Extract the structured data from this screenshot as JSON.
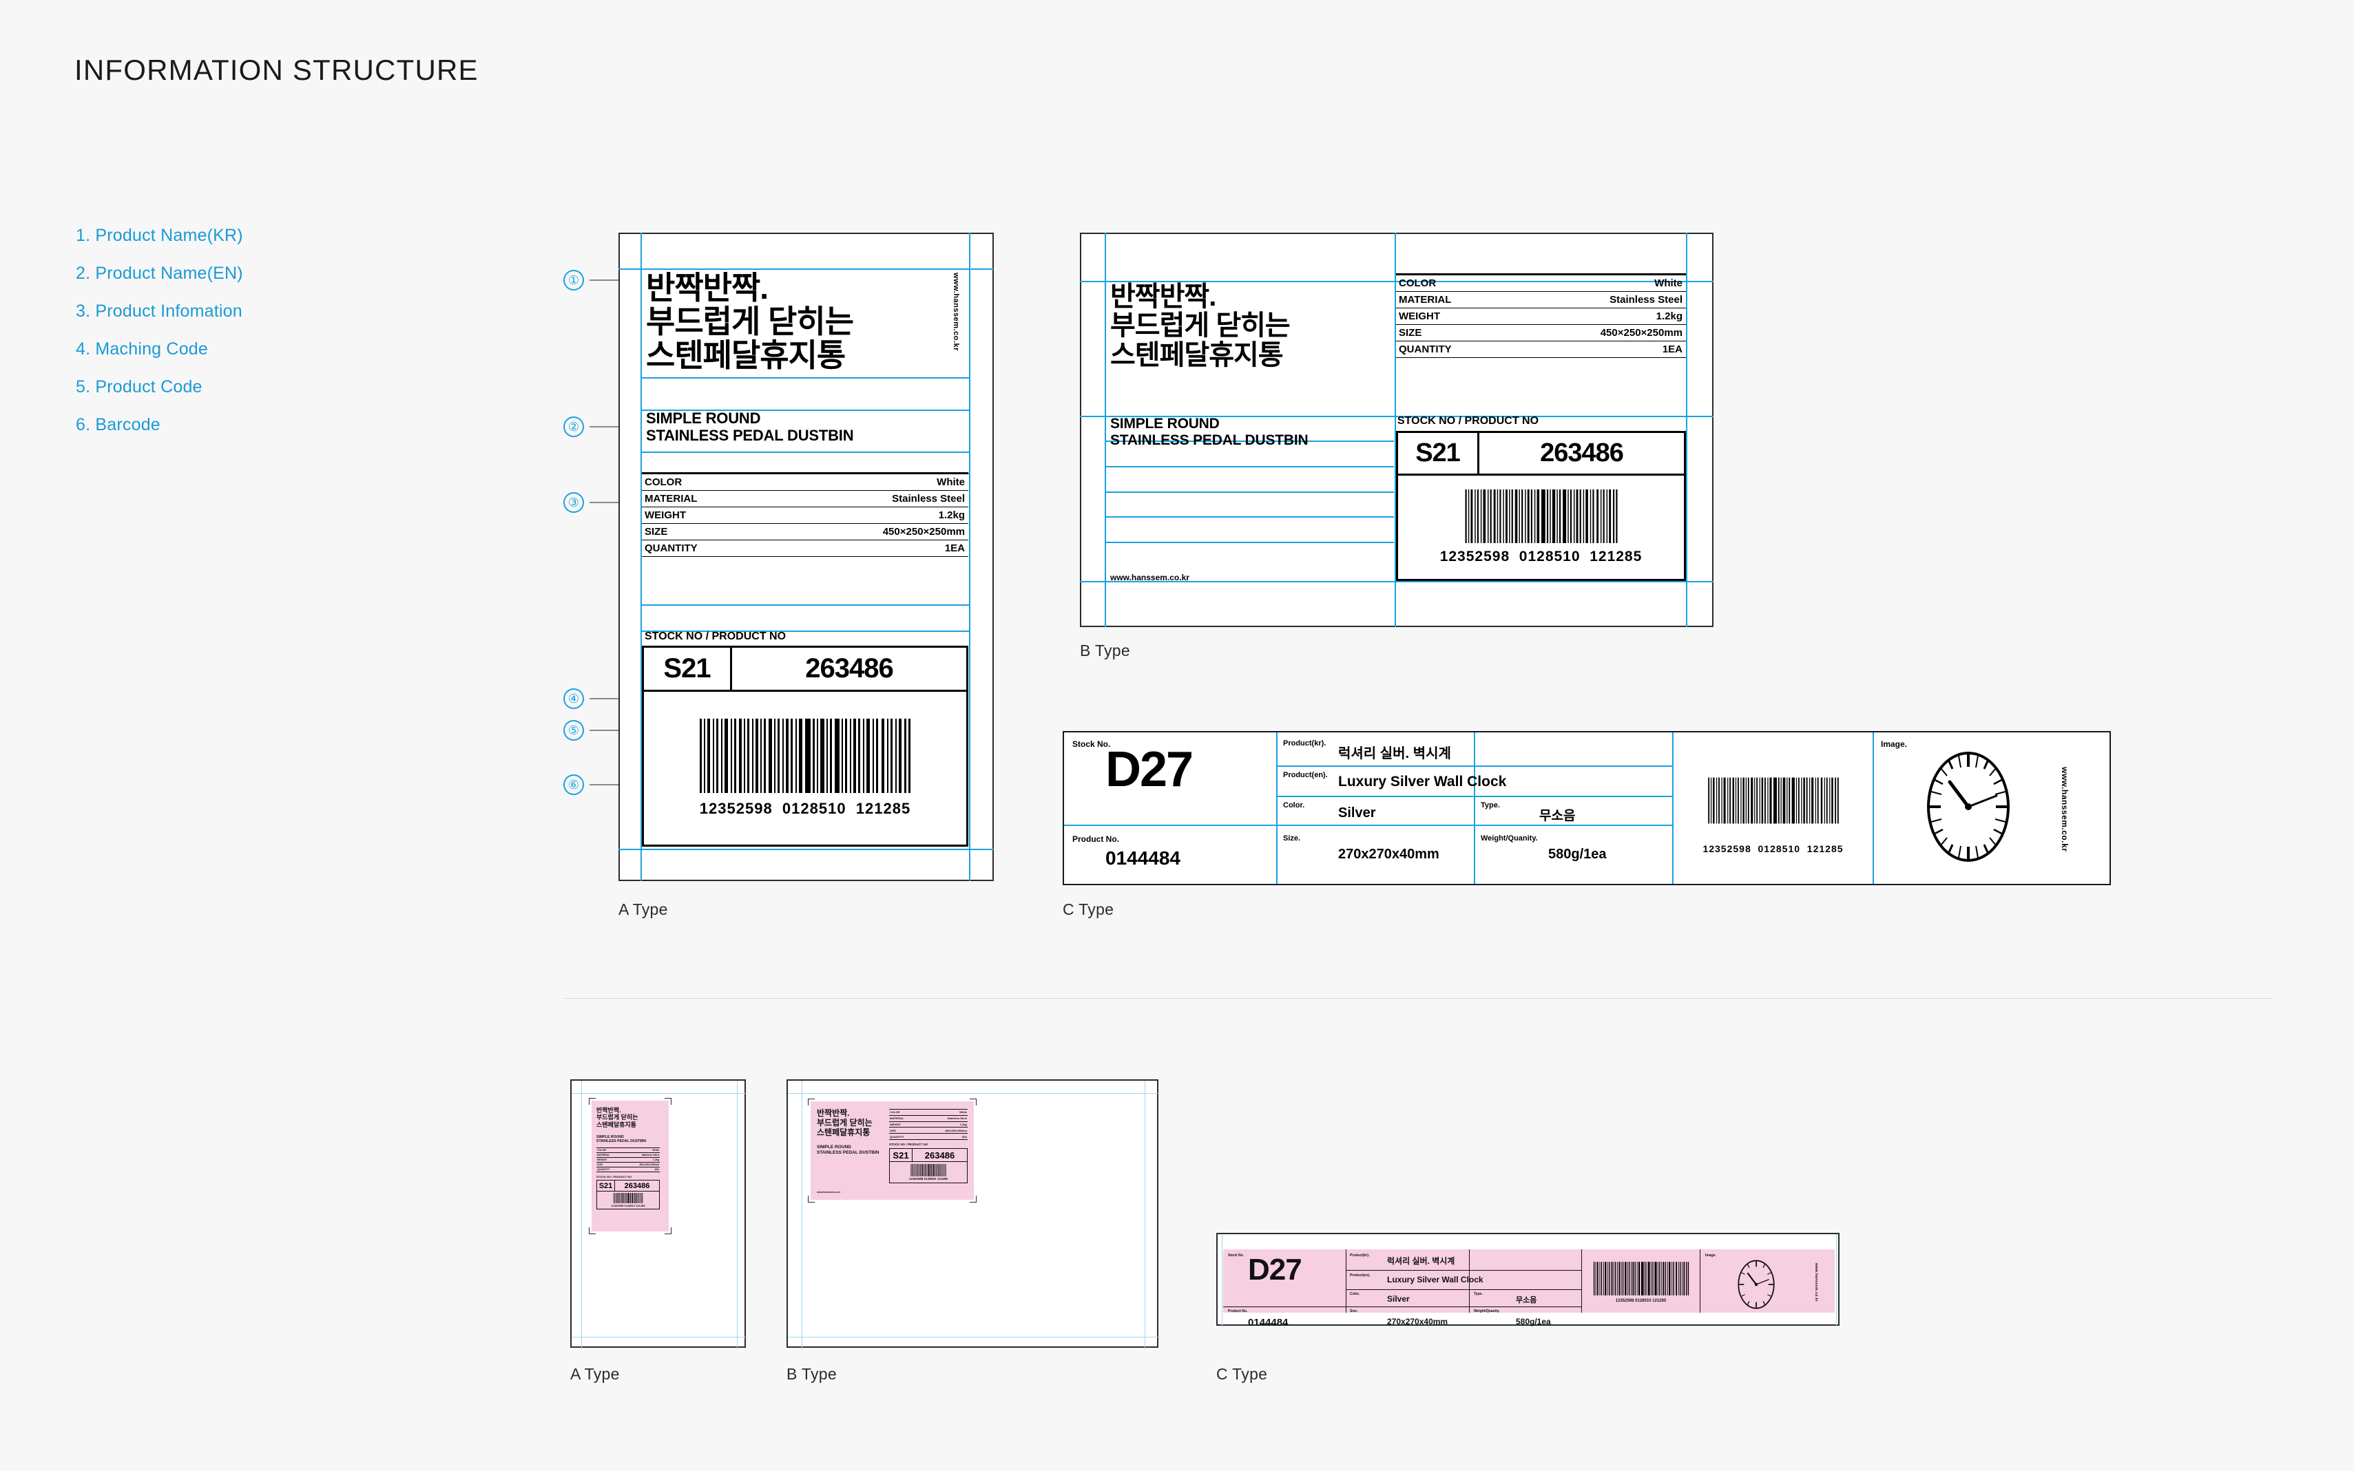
{
  "header": {
    "title": "INFORMATION STRUCTURE"
  },
  "legend": {
    "items": [
      "1. Product Name(KR)",
      "2. Product Name(EN)",
      "3. Product Infomation",
      "4. Maching Code",
      "5. Product Code",
      "6. Barcode"
    ]
  },
  "callouts": [
    "①",
    "②",
    "③",
    "④",
    "⑤",
    "⑥"
  ],
  "label_a": {
    "caption": "A Type",
    "product_name_kr": "반짝반짝.\n부드럽게 닫히는\n스텐페달휴지통",
    "product_name_en": "SIMPLE ROUND\nSTAINLESS PEDAL DUSTBIN",
    "url": "www.hanssem.co.kr",
    "spec_rows": [
      {
        "label": "COLOR",
        "value": "White"
      },
      {
        "label": "MATERIAL",
        "value": "Stainless Steel"
      },
      {
        "label": "WEIGHT",
        "value": "1.2kg"
      },
      {
        "label": "SIZE",
        "value": "450×250×250mm"
      },
      {
        "label": "QUANTITY",
        "value": "1EA"
      }
    ],
    "stock_title": "STOCK NO / PRODUCT NO",
    "matching_code": "S21",
    "product_code": "263486",
    "barcode_number": "12352598  0128510  121285"
  },
  "label_b": {
    "caption": "B Type",
    "product_name_kr": "반짝반짝.\n부드럽게 닫히는\n스텐페달휴지통",
    "product_name_en": "SIMPLE ROUND\nSTAINLESS PEDAL DUSTBIN",
    "url": "www.hanssem.co.kr",
    "spec_rows": [
      {
        "label": "COLOR",
        "value": "White"
      },
      {
        "label": "MATERIAL",
        "value": "Stainless Steel"
      },
      {
        "label": "WEIGHT",
        "value": "1.2kg"
      },
      {
        "label": "SIZE",
        "value": "450×250×250mm"
      },
      {
        "label": "QUANTITY",
        "value": "1EA"
      }
    ],
    "stock_title": "STOCK NO / PRODUCT NO",
    "matching_code": "S21",
    "product_code": "263486",
    "barcode_number": "12352598  0128510  121285"
  },
  "label_c": {
    "caption": "C Type",
    "stock_no_label": "Stock No.",
    "stock_no_value": "D27",
    "product_no_label": "Product No.",
    "product_no_value": "0144484",
    "product_kr_label": "Product(kr).",
    "product_kr_value": "럭셔리 실버. 벽시계",
    "product_en_label": "Product(en).",
    "product_en_value": "Luxury Silver Wall Clock",
    "color_label": "Color.",
    "color_value": "Silver",
    "type_label": "Type.",
    "type_value": "무소음",
    "size_label": "Size.",
    "size_value": "270x270x40mm",
    "weight_label": "Weight/Quanity.",
    "weight_value": "580g/1ea",
    "barcode_number": "12352598  0128510  121285",
    "image_label": "Image.",
    "url": "www.hanssem.co.kr"
  },
  "mockups": {
    "a": {
      "caption": "A Type",
      "product_name_kr": "반짝반짝.\n부드럽게 닫히는\n스텐페달휴지통",
      "product_name_en": "SIMPLE ROUND\nSTAINLESS PEDAL DUSTBIN",
      "spec_rows": [
        {
          "label": "COLOR",
          "value": "White"
        },
        {
          "label": "MATERIAL",
          "value": "Stainless Steel"
        },
        {
          "label": "WEIGHT",
          "value": "1.2kg"
        },
        {
          "label": "SIZE",
          "value": "450×250×250mm"
        },
        {
          "label": "QUANTITY",
          "value": "1EA"
        }
      ],
      "stock_title": "STOCK NO / PRODUCT NO",
      "matching_code": "S21",
      "product_code": "263486",
      "barcode_number": "12352598 0128510 121285"
    },
    "b": {
      "caption": "B Type",
      "product_name_kr": "반짝반짝.\n부드럽게 닫히는\n스텐페달휴지통",
      "product_name_en": "SIMPLE ROUND\nSTAINLESS PEDAL DUSTBIN",
      "url": "www.hanssem.co.kr",
      "spec_rows": [
        {
          "label": "COLOR",
          "value": "White"
        },
        {
          "label": "MATERIAL",
          "value": "Stainless Steel"
        },
        {
          "label": "WEIGHT",
          "value": "1.2kg"
        },
        {
          "label": "SIZE",
          "value": "450×250×250mm"
        },
        {
          "label": "QUANTITY",
          "value": "1EA"
        }
      ],
      "stock_title": "STOCK NO / PRODUCT NO",
      "matching_code": "S21",
      "product_code": "263486",
      "barcode_number": "12352598 0128510 121285"
    },
    "c": {
      "caption": "C Type",
      "stock_no_label": "Stock No.",
      "stock_no_value": "D27",
      "product_no_label": "Product No.",
      "product_no_value": "0144484",
      "product_kr_label": "Product(kr).",
      "product_kr_value": "럭셔리 실버. 벽시계",
      "product_en_label": "Product(en).",
      "product_en_value": "Luxury Silver Wall Clock",
      "color_label": "Color.",
      "color_value": "Silver",
      "type_label": "Type.",
      "type_value": "무소음",
      "size_label": "Size.",
      "size_value": "270x270x40mm",
      "weight_label": "Weight/Quanity.",
      "weight_value": "580g/1ea",
      "barcode_number": "12352598 0128510 121285",
      "image_label": "Image.",
      "url": "www.hanssem.co.kr"
    }
  },
  "colors": {
    "accent": "#17a3e0",
    "ink": "#1a1a1a",
    "background": "#f7f7f7",
    "mockup_pink": "#f6cfe1"
  }
}
